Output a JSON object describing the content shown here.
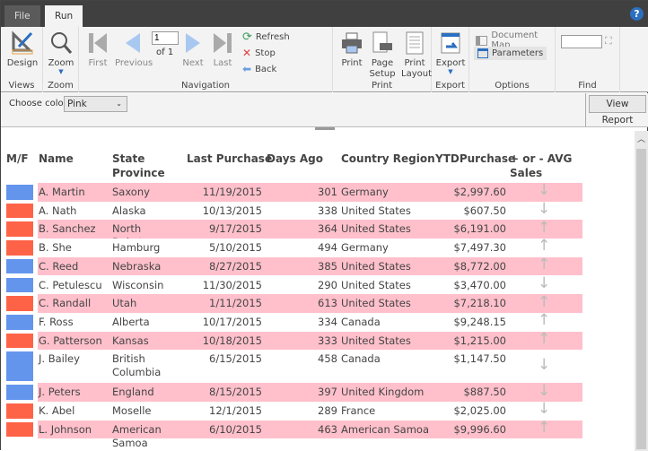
{
  "tabs": [
    {
      "label": "File"
    },
    {
      "label": "Run"
    }
  ],
  "help_icon": "question-circle-icon",
  "ribbon": {
    "design": "Design",
    "zoom": "Zoom",
    "first": "First",
    "previous": "Previous",
    "page": "1",
    "of_label": "of",
    "total_pages": "1",
    "next": "Next",
    "last": "Last",
    "refresh": "Refresh",
    "stop": "Stop",
    "back": "Back",
    "print": "Print",
    "page_setup": "Page Setup",
    "print_layout": "Print Layout",
    "export": "Export",
    "document_map": "Document Map",
    "parameters": "Parameters",
    "find_value": "",
    "groups": {
      "views": "Views",
      "zoom": "Zoom",
      "navigation": "Navigation",
      "print": "Print",
      "export": "Export",
      "options": "Options",
      "find": "Find"
    }
  },
  "params": {
    "label": "Choose color",
    "value": "Pink",
    "view_report": "View Report"
  },
  "colors": {
    "highlight": "#ffc0cb",
    "male": "#6495ed",
    "female": "#ff6347"
  },
  "table": {
    "headers": [
      "M/F",
      "Name",
      "State Province",
      "Last Purchase",
      "Days Ago",
      "Country Region",
      "YTDPurchase",
      "+ or - AVG Sales"
    ],
    "rows": [
      {
        "gender": "M",
        "name": "A. Martin",
        "state": "Saxony",
        "last": "11/19/2015",
        "days": "301",
        "country": "Germany",
        "ytd": "$2,997.60",
        "trend": "down"
      },
      {
        "gender": "F",
        "name": "A. Nath",
        "state": "Alaska",
        "last": "10/13/2015",
        "days": "338",
        "country": "United States",
        "ytd": "$607.50",
        "trend": "down"
      },
      {
        "gender": "F",
        "name": "B. Sanchez",
        "state": "North Dakota",
        "last": "9/17/2015",
        "days": "364",
        "country": "United States",
        "ytd": "$6,191.00",
        "trend": "up"
      },
      {
        "gender": "F",
        "name": "B. She",
        "state": "Hamburg",
        "last": "5/10/2015",
        "days": "494",
        "country": "Germany",
        "ytd": "$7,497.30",
        "trend": "up"
      },
      {
        "gender": "M",
        "name": "C. Reed",
        "state": "Nebraska",
        "last": "8/27/2015",
        "days": "385",
        "country": "United States",
        "ytd": "$8,772.00",
        "trend": "up"
      },
      {
        "gender": "M",
        "name": "C. Petulescu",
        "state": "Wisconsin",
        "last": "11/30/2015",
        "days": "290",
        "country": "United States",
        "ytd": "$3,470.00",
        "trend": "down"
      },
      {
        "gender": "F",
        "name": "C. Randall",
        "state": "Utah",
        "last": "1/11/2015",
        "days": "613",
        "country": "United States",
        "ytd": "$7,218.10",
        "trend": "up"
      },
      {
        "gender": "M",
        "name": "F. Ross",
        "state": "Alberta",
        "last": "10/17/2015",
        "days": "334",
        "country": "Canada",
        "ytd": "$9,248.15",
        "trend": "up"
      },
      {
        "gender": "F",
        "name": "G. Patterson",
        "state": "Kansas",
        "last": "10/18/2015",
        "days": "333",
        "country": "United States",
        "ytd": "$1,215.00",
        "trend": "up"
      },
      {
        "gender": "M",
        "name": "J. Bailey",
        "state": "British Columbia",
        "last": "6/15/2015",
        "days": "458",
        "country": "Canada",
        "ytd": "$1,147.50",
        "trend": "down"
      },
      {
        "gender": "M",
        "name": "J. Peters",
        "state": "England",
        "last": "8/15/2015",
        "days": "397",
        "country": "United Kingdom",
        "ytd": "$887.50",
        "trend": "down"
      },
      {
        "gender": "F",
        "name": "K. Abel",
        "state": "Moselle",
        "last": "12/1/2015",
        "days": "289",
        "country": "France",
        "ytd": "$2,025.00",
        "trend": "down"
      },
      {
        "gender": "F",
        "name": "L. Johnson",
        "state": "American Samoa",
        "last": "6/10/2015",
        "days": "463",
        "country": "American Samoa",
        "ytd": "$9,996.60",
        "trend": "up"
      }
    ]
  }
}
